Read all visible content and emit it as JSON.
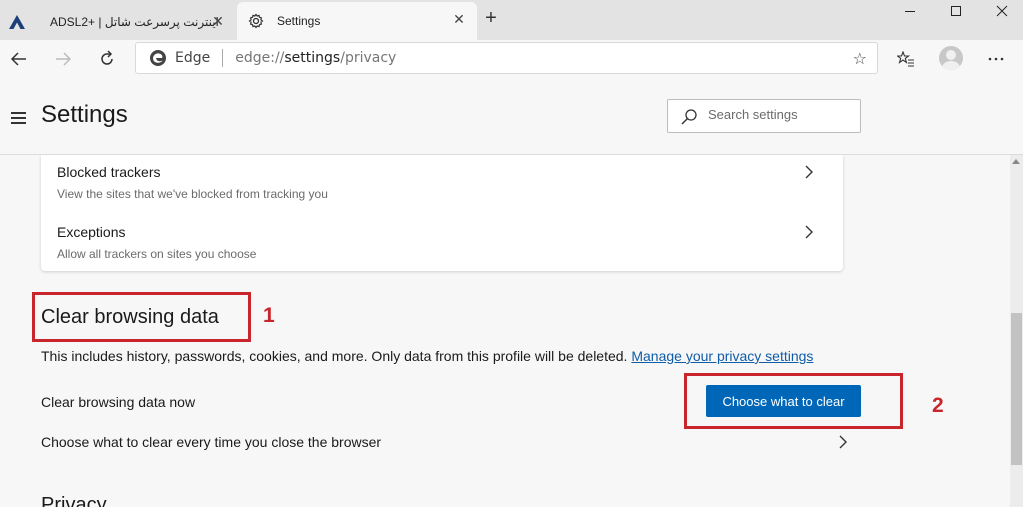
{
  "browser": {
    "tabs": [
      {
        "title": "اینترنت پرسرعت شاتل | +ADSL2",
        "logo": "shatel-logo",
        "close_icon": "close-icon"
      },
      {
        "title": "Settings",
        "logo": "gear-icon",
        "close_icon": "close-icon",
        "active": true
      }
    ],
    "new_tab_glyph": "+",
    "window_controls": [
      "minimize-icon",
      "maximize-icon",
      "close-icon"
    ],
    "address": {
      "site_name": "Edge",
      "url_prefix": "edge://",
      "url_host": "settings",
      "url_path": "/privacy"
    }
  },
  "settings": {
    "title": "Settings",
    "search_placeholder": "Search settings"
  },
  "trackers_card": {
    "rows": [
      {
        "title": "Blocked trackers",
        "subtitle": "View the sites that we've blocked from tracking you"
      },
      {
        "title": "Exceptions",
        "subtitle": "Allow all trackers on sites you choose"
      }
    ]
  },
  "clear_browsing": {
    "title": "Clear browsing data",
    "description": "This includes history, passwords, cookies, and more. Only data from this profile will be deleted.",
    "manage_link": "Manage your privacy settings",
    "clear_now_label": "Clear browsing data now",
    "choose_button": "Choose what to clear",
    "on_close_label": "Choose what to clear every time you close the browser"
  },
  "annotations": {
    "marker_1": "1",
    "marker_2": "2",
    "color": "#c8262c"
  },
  "next_section_title": "Privacy",
  "colors": {
    "accent": "#0067b8",
    "link": "#0f5ca8"
  }
}
